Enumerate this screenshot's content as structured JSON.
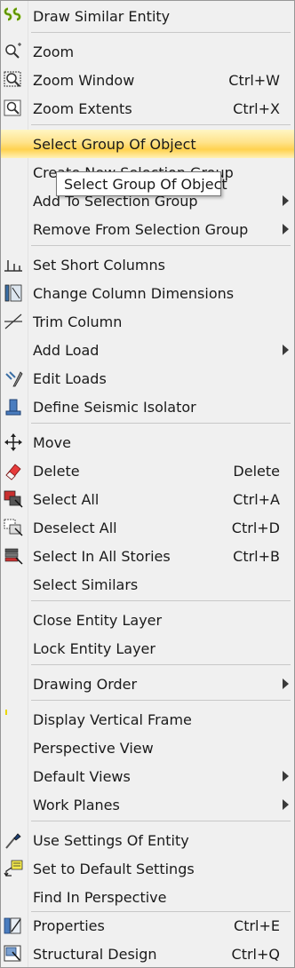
{
  "menu": {
    "items": [
      {
        "label": "Draw Similar Entity",
        "shortcut": "",
        "icon": "draw-similar-icon"
      },
      {
        "label": "Zoom",
        "shortcut": "",
        "icon": "zoom-icon"
      },
      {
        "label": "Zoom Window",
        "shortcut": "Ctrl+W",
        "icon": "zoom-window-icon"
      },
      {
        "label": "Zoom Extents",
        "shortcut": "Ctrl+X",
        "icon": "zoom-extents-icon"
      },
      {
        "label": "Select Group Of Object",
        "shortcut": "",
        "icon": ""
      },
      {
        "label": "Create New Selection Group",
        "shortcut": "",
        "icon": ""
      },
      {
        "label": "Add To Selection Group",
        "shortcut": "",
        "icon": ""
      },
      {
        "label": "Remove From Selection Group",
        "shortcut": "",
        "icon": ""
      },
      {
        "label": "Set Short Columns",
        "shortcut": "",
        "icon": "short-columns-icon"
      },
      {
        "label": "Change Column Dimensions",
        "shortcut": "",
        "icon": "column-dimensions-icon"
      },
      {
        "label": "Trim Column",
        "shortcut": "",
        "icon": "trim-column-icon"
      },
      {
        "label": "Add Load",
        "shortcut": "",
        "icon": ""
      },
      {
        "label": "Edit Loads",
        "shortcut": "",
        "icon": "edit-loads-icon"
      },
      {
        "label": "Define Seismic Isolator",
        "shortcut": "",
        "icon": "seismic-isolator-icon"
      },
      {
        "label": "Move",
        "shortcut": "",
        "icon": "move-icon"
      },
      {
        "label": "Delete",
        "shortcut": "Delete",
        "icon": "eraser-icon"
      },
      {
        "label": "Select All",
        "shortcut": "Ctrl+A",
        "icon": "select-all-icon"
      },
      {
        "label": "Deselect All",
        "shortcut": "Ctrl+D",
        "icon": "deselect-all-icon"
      },
      {
        "label": "Select In All Stories",
        "shortcut": "Ctrl+B",
        "icon": "select-all-stories-icon"
      },
      {
        "label": "Select Similars",
        "shortcut": "",
        "icon": ""
      },
      {
        "label": "Close Entity Layer",
        "shortcut": "",
        "icon": ""
      },
      {
        "label": "Lock Entity Layer",
        "shortcut": "",
        "icon": ""
      },
      {
        "label": "Drawing Order",
        "shortcut": "",
        "icon": ""
      },
      {
        "label": "Display Vertical Frame",
        "shortcut": "",
        "icon": ""
      },
      {
        "label": "Perspective View",
        "shortcut": "",
        "icon": ""
      },
      {
        "label": "Default Views",
        "shortcut": "",
        "icon": ""
      },
      {
        "label": "Work Planes",
        "shortcut": "",
        "icon": ""
      },
      {
        "label": "Use Settings Of Entity",
        "shortcut": "",
        "icon": "eyedropper-icon"
      },
      {
        "label": "Set to Default Settings",
        "shortcut": "",
        "icon": "default-settings-icon"
      },
      {
        "label": "Find In Perspective",
        "shortcut": "",
        "icon": ""
      },
      {
        "label": "Properties",
        "shortcut": "Ctrl+E",
        "icon": "properties-icon"
      },
      {
        "label": "Structural Design",
        "shortcut": "Ctrl+Q",
        "icon": "structural-design-icon"
      }
    ],
    "tooltip": "Select Group Of Object",
    "highlight_color": "#ffd24f"
  }
}
